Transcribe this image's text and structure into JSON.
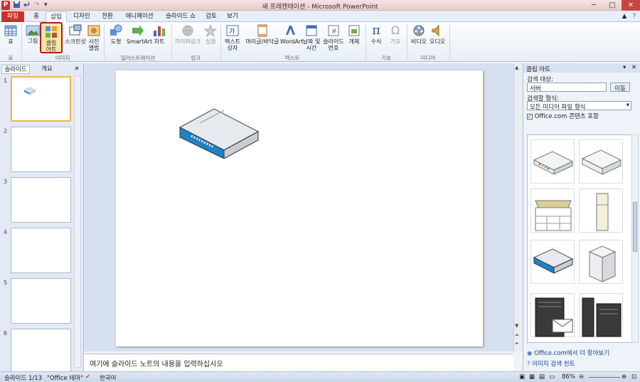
{
  "titlebar": {
    "title": "새 프레젠테이션 - Microsoft PowerPoint",
    "app_letter": "P",
    "minimize": "─",
    "maximize": "□",
    "close": "✕"
  },
  "tabs": [
    "파일",
    "홈",
    "삽입",
    "디자인",
    "전환",
    "애니메이션",
    "슬라이드 쇼",
    "검토",
    "보기"
  ],
  "ribbon": {
    "table": "표",
    "image": "그림",
    "clipart": "클립\n아트",
    "screenshot": "스크린샷",
    "album": "사진\n앨범",
    "shapes": "도형",
    "smartart": "SmartArt",
    "chart": "차트",
    "hyperlink": "하이퍼링크",
    "action": "실행",
    "textbox": "텍스트\n상자",
    "headerfooter": "머리글/바닥글",
    "wordart": "WordArt",
    "datetime": "날짜 및\n시간",
    "slidenum": "슬라이드\n번호",
    "object": "개체",
    "equation": "수식",
    "symbol": "기호",
    "video": "비디오",
    "audio": "오디오",
    "groups": {
      "table": "표",
      "images": "이미지",
      "illustrations": "일러스트레이션",
      "links": "링크",
      "text": "텍스트",
      "symbols": "기호",
      "media": "미디어"
    }
  },
  "leftpane": {
    "tab_slides": "슬라이드",
    "tab_outline": "개요",
    "close": "✕",
    "thumbs": [
      "1",
      "2",
      "3",
      "4",
      "5",
      "6"
    ]
  },
  "notes": {
    "placeholder": "여기에 슬라이드 노트의 내용을 입력하십시오"
  },
  "clippane": {
    "title": "클립 아트",
    "search_label": "검색 대상:",
    "search_value": "서버",
    "go_button": "이동",
    "type_label": "검색할 형식:",
    "type_value": "모든 미디어 파일 형식",
    "include_office": "Office.com 콘텐츠 포함",
    "link_more": "Office.com에서 더 찾아보기",
    "link_tips": "이미지 검색 힌트"
  },
  "status": {
    "slide": "슬라이드 1/13",
    "theme": "\"Office 테마\"",
    "lang": "한국어",
    "zoom": "86%"
  },
  "colors": {
    "accent": "#c8312c",
    "selection": "#f8e6a4"
  }
}
